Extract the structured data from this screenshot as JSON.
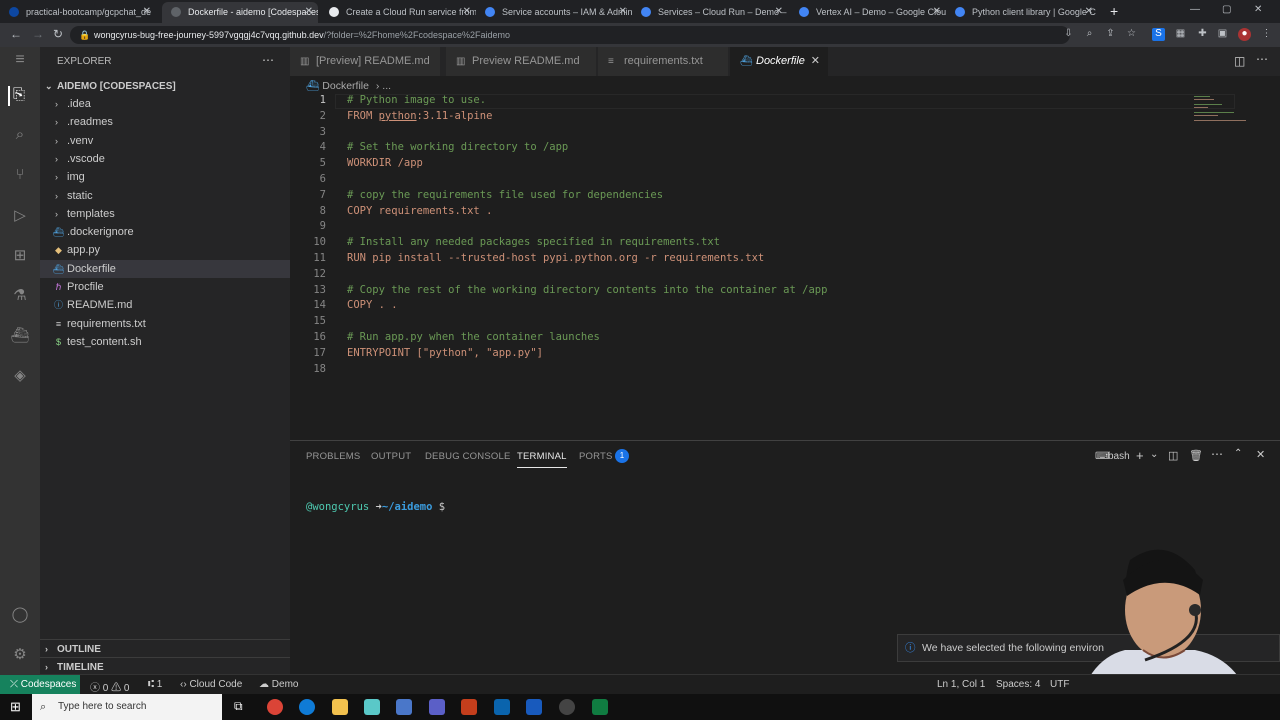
{
  "browser": {
    "tabs": [
      {
        "label": "practical-bootcamp/gcpchat_de",
        "color": "#0d47a1"
      },
      {
        "label": "Dockerfile - aidemo [Codespaces]",
        "color": "#5f6368"
      },
      {
        "label": "Create a Cloud Run service from",
        "color": "#e8eaed"
      },
      {
        "label": "Service accounts – IAM & Admin",
        "color": "#4285f4"
      },
      {
        "label": "Services – Cloud Run – Demo –",
        "color": "#4285f4"
      },
      {
        "label": "Vertex AI – Demo – Google Clou",
        "color": "#4285f4"
      },
      {
        "label": "Python client library | Google C",
        "color": "#4285f4"
      }
    ],
    "url_main": "wongcyrus-bug-free-journey-5997vgqgj4c7vqq.github.dev",
    "url_rest": "/?folder=%2Fhome%2Fcodespace%2Faidemo"
  },
  "explorer": {
    "title": "EXPLORER",
    "root": "AIDEMO [CODESPACES]",
    "folders": [
      ".idea",
      ".readmes",
      ".venv",
      ".vscode",
      "img",
      "static",
      "templates"
    ],
    "files": [
      ".dockerignore",
      "app.py",
      "Dockerfile",
      "Procfile",
      "README.md",
      "requirements.txt",
      "test_content.sh"
    ],
    "outline": "OUTLINE",
    "timeline": "TIMELINE"
  },
  "editor_tabs": [
    "[Preview] README.md",
    "Preview README.md",
    "requirements.txt",
    "Dockerfile"
  ],
  "breadcrumb": [
    "Dockerfile",
    "..."
  ],
  "code_lines": [
    {
      "n": "1",
      "parts": [
        {
          "t": "# Python image to use.",
          "c": "cm"
        }
      ]
    },
    {
      "n": "2",
      "parts": [
        {
          "t": "FROM ",
          "c": "kw2"
        },
        {
          "t": "python",
          "c": "ylw-u"
        },
        {
          "t": ":3.11-alpine",
          "c": "kw2"
        }
      ]
    },
    {
      "n": "3",
      "parts": []
    },
    {
      "n": "4",
      "parts": [
        {
          "t": "# Set the working directory to /app",
          "c": "cm"
        }
      ]
    },
    {
      "n": "5",
      "parts": [
        {
          "t": "WORKDIR /app",
          "c": "kw2"
        }
      ]
    },
    {
      "n": "6",
      "parts": []
    },
    {
      "n": "7",
      "parts": [
        {
          "t": "# copy the requirements file used for dependencies",
          "c": "cm"
        }
      ]
    },
    {
      "n": "8",
      "parts": [
        {
          "t": "COPY requirements.txt .",
          "c": "kw2"
        }
      ]
    },
    {
      "n": "9",
      "parts": []
    },
    {
      "n": "10",
      "parts": [
        {
          "t": "# Install any needed packages specified in requirements.txt",
          "c": "cm"
        }
      ]
    },
    {
      "n": "11",
      "parts": [
        {
          "t": "RUN pip install --trusted-host pypi.python.org -r requirements.txt",
          "c": "kw2"
        }
      ]
    },
    {
      "n": "12",
      "parts": []
    },
    {
      "n": "13",
      "parts": [
        {
          "t": "# Copy the rest of the working directory contents into the container at /app",
          "c": "cm"
        }
      ]
    },
    {
      "n": "14",
      "parts": [
        {
          "t": "COPY . .",
          "c": "kw2"
        }
      ]
    },
    {
      "n": "15",
      "parts": []
    },
    {
      "n": "16",
      "parts": [
        {
          "t": "# Run app.py when the container launches",
          "c": "cm"
        }
      ]
    },
    {
      "n": "17",
      "parts": [
        {
          "t": "ENTRYPOINT ",
          "c": "kw2"
        },
        {
          "t": "[\"python\", \"app.py\"]",
          "c": "kw2"
        }
      ]
    },
    {
      "n": "18",
      "parts": []
    }
  ],
  "panel": {
    "tabs": [
      "PROBLEMS",
      "OUTPUT",
      "DEBUG CONSOLE",
      "TERMINAL",
      "PORTS"
    ],
    "ports_badge": "1",
    "shell": "bash",
    "prompt_user": "@wongcyrus",
    "prompt_arrow": "➜",
    "prompt_path": "~/aidemo",
    "prompt_symbol": "$"
  },
  "toast": "We have selected the following environ",
  "status": {
    "remote": "Codespaces",
    "errors": "0",
    "warnings": "0",
    "ports": "1",
    "cloud_code": "Cloud Code",
    "demo": "Demo",
    "position": "Ln 1, Col 1",
    "spaces": "Spaces: 4",
    "encoding": "UTF"
  },
  "taskbar": {
    "search_placeholder": "Type here to search"
  }
}
